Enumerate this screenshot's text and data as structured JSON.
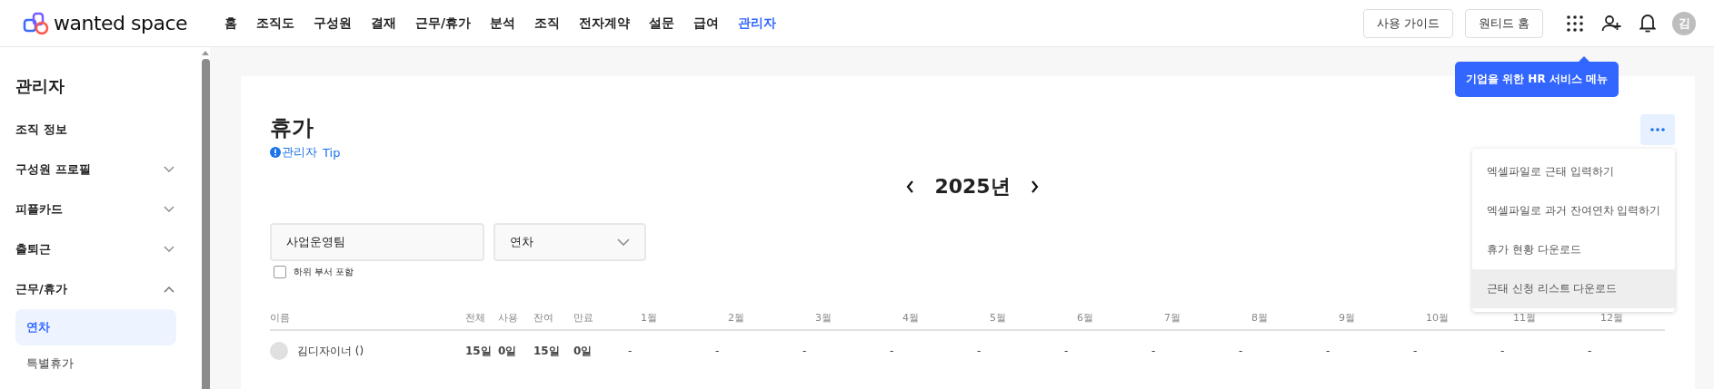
{
  "logo": {
    "text": "wanted space"
  },
  "nav": [
    {
      "label": "홈",
      "selected": false
    },
    {
      "label": "조직도",
      "selected": false
    },
    {
      "label": "구성원",
      "selected": false
    },
    {
      "label": "결재",
      "selected": false
    },
    {
      "label": "근무/휴가",
      "selected": false
    },
    {
      "label": "분석",
      "selected": false
    },
    {
      "label": "조직",
      "selected": false
    },
    {
      "label": "전자계약",
      "selected": false
    },
    {
      "label": "설문",
      "selected": false
    },
    {
      "label": "급여",
      "selected": false
    },
    {
      "label": "관리자",
      "selected": true
    }
  ],
  "header_buttons": [
    "사용 가이드",
    "원티드 홈"
  ],
  "avatar": {
    "initial": "김"
  },
  "tooltip": "기업을 위한 HR 서비스 메뉴",
  "sidebar": {
    "title": "관리자",
    "items": [
      {
        "label": "조직 정보"
      },
      {
        "label": "구성원 프로필",
        "expanded": false
      },
      {
        "label": "피플카드",
        "expanded": false
      },
      {
        "label": "출퇴근",
        "expanded": false
      },
      {
        "label": "근무/휴가",
        "expanded": true,
        "children": [
          {
            "label": "연차",
            "selected": true
          },
          {
            "label": "특별휴가",
            "selected": false
          }
        ]
      }
    ]
  },
  "page": {
    "title": "휴가",
    "tip_label": "관리자",
    "tip_link": "Tip"
  },
  "year": {
    "label": "2025년"
  },
  "filters": {
    "department": "사업운영팀",
    "type": "연차",
    "include_sub": {
      "label": "하위 부서 포함",
      "checked": false
    }
  },
  "table": {
    "columns": [
      "이름",
      "전체",
      "사용",
      "잔여",
      "만료",
      "1월",
      "2월",
      "3월",
      "4월",
      "5월",
      "6월",
      "7월",
      "8월",
      "9월",
      "10월",
      "11월",
      "12월"
    ],
    "rows": [
      {
        "cells": [
          "김디자이너 ()",
          "15일",
          "0일",
          "15일",
          "0일",
          "-",
          "-",
          "-",
          "-",
          "-",
          "-",
          "-",
          "-",
          "-",
          "-",
          "-",
          "-"
        ]
      }
    ]
  },
  "menu": {
    "items": [
      {
        "label": "엑셀파일로 근태 입력하기",
        "highlighted": false
      },
      {
        "label": "엑셀파일로 과거 잔여연차 입력하기",
        "highlighted": false
      },
      {
        "label": "휴가 현황 다운로드",
        "highlighted": false
      },
      {
        "label": "근태 신청 리스트 다운로드",
        "highlighted": true
      }
    ]
  }
}
